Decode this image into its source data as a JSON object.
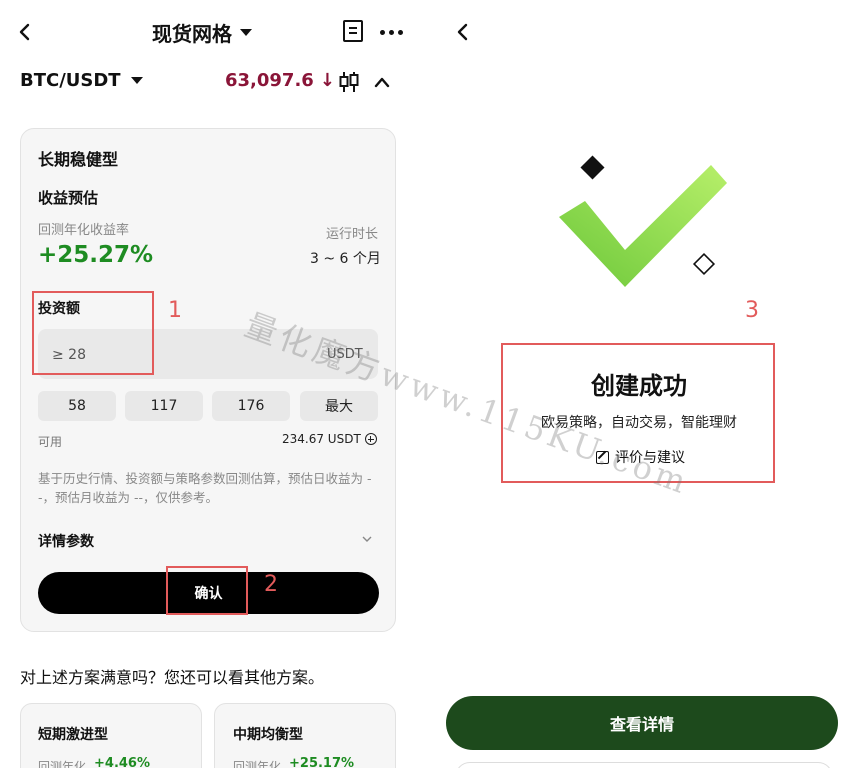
{
  "header": {
    "title": "现货网格",
    "pair": "BTC/USDT",
    "price": "63,097.6",
    "price_trend": "↓"
  },
  "strategy_card": {
    "title": "长期稳健型",
    "section_title": "收益预估",
    "rate_label": "回测年化收益率",
    "rate_value": "+25.27%",
    "duration_label": "运行时长",
    "duration_value": "3 ~ 6 个月",
    "invest_label": "投资额",
    "input_placeholder": "≥ 28",
    "input_unit": "USDT",
    "quick_amounts": [
      "58",
      "117",
      "176",
      "最大"
    ],
    "available_label": "可用",
    "available_value": "234.67 USDT",
    "note": "基于历史行情、投资额与策略参数回测估算，预估日收益为 --，预估月收益为 --，仅供参考。",
    "details_label": "详情参数",
    "confirm_label": "确认"
  },
  "other_plans": {
    "prompt": "对上述方案满意吗？您还可以看其他方案。",
    "plans": [
      {
        "title": "短期激进型",
        "rate_label": "回测年化",
        "rate": "+4.46%"
      },
      {
        "title": "中期均衡型",
        "rate_label": "回测年化",
        "rate": "+25.17%"
      }
    ]
  },
  "success": {
    "title": "创建成功",
    "subtitle": "欧易策略，自动交易，智能理财",
    "review_link": "评价与建议",
    "view_details": "查看详情"
  },
  "annotations": {
    "num1": "1",
    "num2": "2",
    "num3": "3"
  },
  "watermark": "量化魔方www.115KU.com",
  "colors": {
    "positive": "#1e8c22",
    "price": "#8a1538",
    "primary_button": "#000000",
    "success_button": "#1d4a1c",
    "callout": "#e25b5b"
  }
}
